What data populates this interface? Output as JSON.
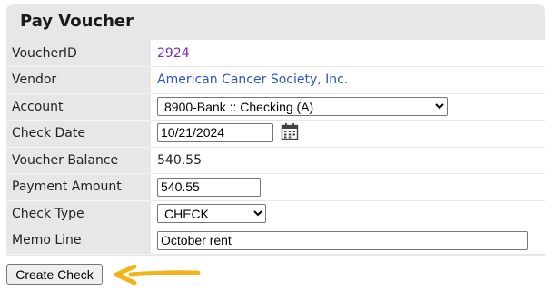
{
  "panel": {
    "title": "Pay Voucher"
  },
  "fields": {
    "voucher_id": {
      "label": "VoucherID",
      "value": "2924"
    },
    "vendor": {
      "label": "Vendor",
      "value": "American Cancer Society, Inc."
    },
    "account": {
      "label": "Account",
      "selected": "8900-Bank :: Checking (A)"
    },
    "check_date": {
      "label": "Check Date",
      "value": "10/21/2024"
    },
    "voucher_balance": {
      "label": "Voucher Balance",
      "value": "540.55"
    },
    "payment_amount": {
      "label": "Payment Amount",
      "value": "540.55"
    },
    "check_type": {
      "label": "Check Type",
      "selected": "CHECK"
    },
    "memo_line": {
      "label": "Memo Line",
      "value": "October rent"
    }
  },
  "actions": {
    "create_check_label": "Create Check"
  },
  "colors": {
    "panel_bg": "#e7e7e7",
    "voucher_id_link": "#7a2fb5",
    "vendor_link": "#2e54c8",
    "arrow": "#f2b41c"
  },
  "icons": {
    "check_date": "calendar-icon",
    "annotation": "arrow-left-icon"
  }
}
